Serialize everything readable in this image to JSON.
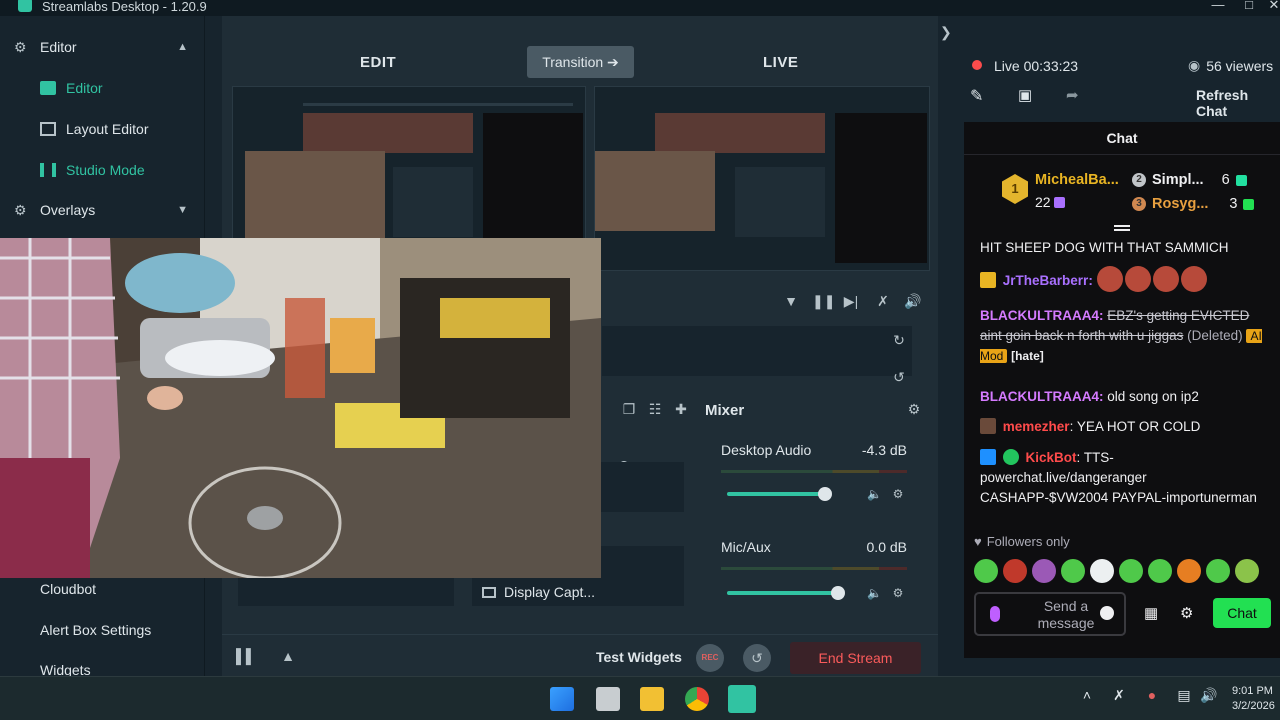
{
  "window": {
    "title": "Streamlabs Desktop - 1.20.9"
  },
  "sidebar": {
    "editor_section": "Editor",
    "items": [
      {
        "label": "Editor",
        "active": true
      },
      {
        "label": "Layout Editor",
        "active": false
      },
      {
        "label": "Studio Mode",
        "active": true
      }
    ],
    "overlays_section": "Overlays",
    "lower_items": [
      "Cloudbot",
      "Alert Box Settings",
      "Widgets"
    ]
  },
  "studio": {
    "edit_label": "EDIT",
    "live_label": "LIVE",
    "transition_label": "Transition ➔",
    "mixer_title": "Mixer",
    "source_label": "Display Capt...",
    "audio": [
      {
        "name": "Desktop Audio",
        "db": "-4.3 dB",
        "level": 0.85
      },
      {
        "name": "Mic/Aux",
        "db": "0.0 dB",
        "level": 0.95
      }
    ],
    "test_widgets": "Test Widgets",
    "rec_label": "REC",
    "end_stream": "End Stream"
  },
  "stream": {
    "live_label": "Live",
    "uptime": "00:33:23",
    "viewers": "56 viewers",
    "refresh_chat": "Refresh Chat",
    "chat_title": "Chat"
  },
  "leaderboard": {
    "first": {
      "name": "MichealBa...",
      "count": "22"
    },
    "second": {
      "name": "Simpl...",
      "count": "6"
    },
    "third": {
      "name": "Rosyg...",
      "count": "3"
    }
  },
  "chat": {
    "pinned_line": "HIT SHEEP DOG WITH THAT SAMMICH",
    "messages": [
      {
        "user": "JrTheBarberr",
        "text": "",
        "user_color": "#a970ff"
      },
      {
        "user": "BLACKULTRAAA4",
        "text": "EBZ's getting EVICTED aint goin back n forth with u jiggas",
        "deleted_tag": "(Deleted)",
        "mod_tag": "AI Mod",
        "reason": "[hate]",
        "user_color": "#d57bff"
      },
      {
        "user": "BLACKULTRAAA4",
        "text": "old song on ip2",
        "user_color": "#d57bff"
      },
      {
        "user": "memezher",
        "text": "YEA HOT OR COLD",
        "user_color": "#ff4b4b"
      },
      {
        "user": "KickBot",
        "text": "TTS-powerchat.live/dangeranger CASHAPP-$VW2004 PAYPAL-importunerman",
        "user_color": "#ff4b4b"
      }
    ],
    "followers_only": "Followers only",
    "input_placeholder": "Send a message",
    "send_label": "Chat"
  },
  "taskbar": {
    "time": "9:01 PM",
    "date": "3/2/2026"
  },
  "colors": {
    "accent": "#31c3a2",
    "chat_send": "#22e052",
    "end_stream": "#fb5b5b"
  }
}
